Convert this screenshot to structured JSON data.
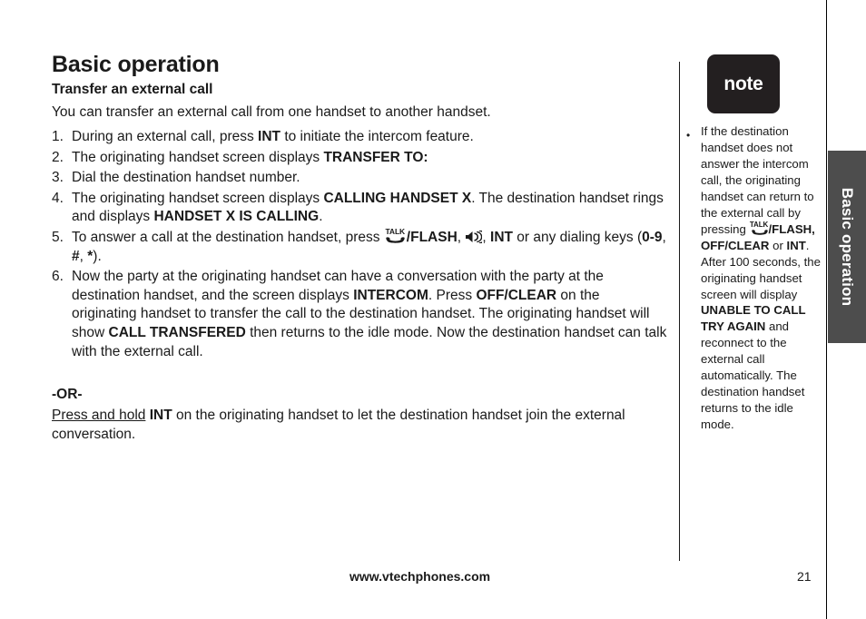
{
  "page": {
    "title": "Basic operation",
    "section_title": "Transfer an external call",
    "intro": "You can transfer an external call from one handset to another handset."
  },
  "steps": [
    {
      "num": "1.",
      "parts": [
        {
          "t": "text",
          "v": "During an external call, press "
        },
        {
          "t": "bold",
          "v": "INT"
        },
        {
          "t": "text",
          "v": " to initiate the intercom feature."
        }
      ]
    },
    {
      "num": "2.",
      "parts": [
        {
          "t": "text",
          "v": "The originating handset screen displays "
        },
        {
          "t": "bold",
          "v": "TRANSFER TO:"
        }
      ]
    },
    {
      "num": "3.",
      "parts": [
        {
          "t": "text",
          "v": "Dial the destination handset number."
        }
      ]
    },
    {
      "num": "4.",
      "parts": [
        {
          "t": "text",
          "v": "The originating handset screen displays "
        },
        {
          "t": "bold",
          "v": "CALLING HANDSET X"
        },
        {
          "t": "text",
          "v": ". The destination handset rings and displays "
        },
        {
          "t": "bold",
          "v": "HANDSET X IS CALLING"
        },
        {
          "t": "text",
          "v": "."
        }
      ]
    },
    {
      "num": "5.",
      "parts": [
        {
          "t": "text",
          "v": "To answer a call at the destination handset, press "
        },
        {
          "t": "talk-icon",
          "v": "TALK"
        },
        {
          "t": "bold",
          "v": "/FLASH"
        },
        {
          "t": "text",
          "v": ", "
        },
        {
          "t": "speaker-icon",
          "v": "speaker"
        },
        {
          "t": "text",
          "v": ", "
        },
        {
          "t": "bold",
          "v": "INT"
        },
        {
          "t": "text",
          "v": " or any dialing keys ("
        },
        {
          "t": "bold",
          "v": "0-9"
        },
        {
          "t": "text",
          "v": ", "
        },
        {
          "t": "bold",
          "v": "#"
        },
        {
          "t": "text",
          "v": ", "
        },
        {
          "t": "bold",
          "v": "*"
        },
        {
          "t": "text",
          "v": ")."
        }
      ]
    },
    {
      "num": "6.",
      "justify": true,
      "parts": [
        {
          "t": "text",
          "v": "Now the party at the originating handset can have a conversation with the party at the destination handset, and the screen displays "
        },
        {
          "t": "bold",
          "v": "INTERCOM"
        },
        {
          "t": "text",
          "v": ". Press "
        },
        {
          "t": "bold",
          "v": "OFF/CLEAR"
        },
        {
          "t": "text",
          "v": " on the originating handset to transfer the call to the destination handset. The originating handset will show "
        },
        {
          "t": "bold",
          "v": "CALL TRANSFERED"
        },
        {
          "t": "text",
          "v": " then returns to the idle mode. Now the destination handset can talk with the external call."
        }
      ]
    }
  ],
  "alternative": {
    "or_label": "-OR-",
    "parts": [
      {
        "t": "underline",
        "v": "Press and hold"
      },
      {
        "t": "text",
        "v": " "
      },
      {
        "t": "bold",
        "v": "INT"
      },
      {
        "t": "text",
        "v": " on the originating handset to let the destination handset join the external conversation."
      }
    ]
  },
  "note": {
    "badge_label": "note",
    "bullet": "•",
    "parts": [
      {
        "t": "text",
        "v": "If the destination handset does not answer the intercom call, the originating handset can return to the external call by pressing "
      },
      {
        "t": "talk-icon-small",
        "v": "TALK"
      },
      {
        "t": "bold",
        "v": "/FLASH, OFF/CLEAR"
      },
      {
        "t": "text",
        "v": " or "
      },
      {
        "t": "bold",
        "v": "INT"
      },
      {
        "t": "text",
        "v": ". After 100 seconds, the originating handset screen will display "
      },
      {
        "t": "bold",
        "v": "UNABLE TO CALL TRY AGAIN"
      },
      {
        "t": "text",
        "v": " and reconnect to the external call automatically. The destination handset returns to the idle mode."
      }
    ]
  },
  "chapter_tab": {
    "label": "Basic operation",
    "color": "#4d4d4d"
  },
  "footer": {
    "url": "www.vtechphones.com",
    "page_number": "21"
  }
}
